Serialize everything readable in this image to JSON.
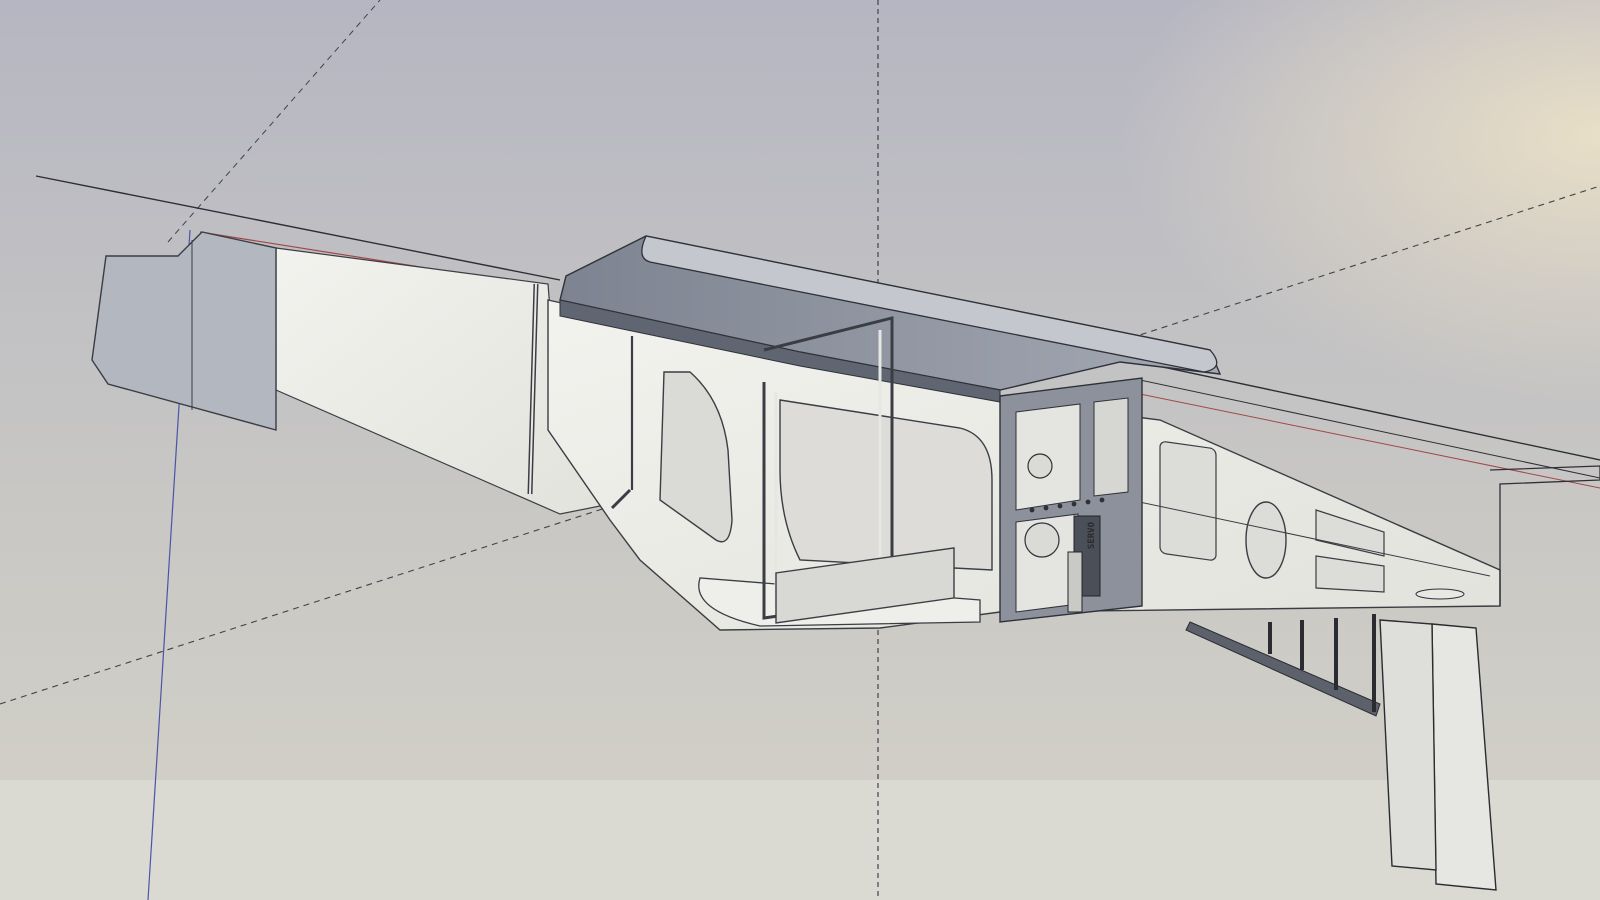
{
  "app": {
    "view": "3d-model-viewport"
  },
  "model": {
    "panel_label": "SERVO"
  },
  "colors": {
    "background_top": "#b9b9c3",
    "background_bottom": "#d2d0c6",
    "floor_strip": "#dcdcd4",
    "panel_fill": "#eeeeea",
    "shaded_fill": "#9ea3ae",
    "dark_fill": "#6f7580",
    "edge": "#3a3d44",
    "axis_red": "#a04848",
    "axis_blue": "#4a54a8",
    "axis_dashed": "#40434a"
  },
  "icons": {
    "axis_origin": "axis-origin-icon"
  }
}
